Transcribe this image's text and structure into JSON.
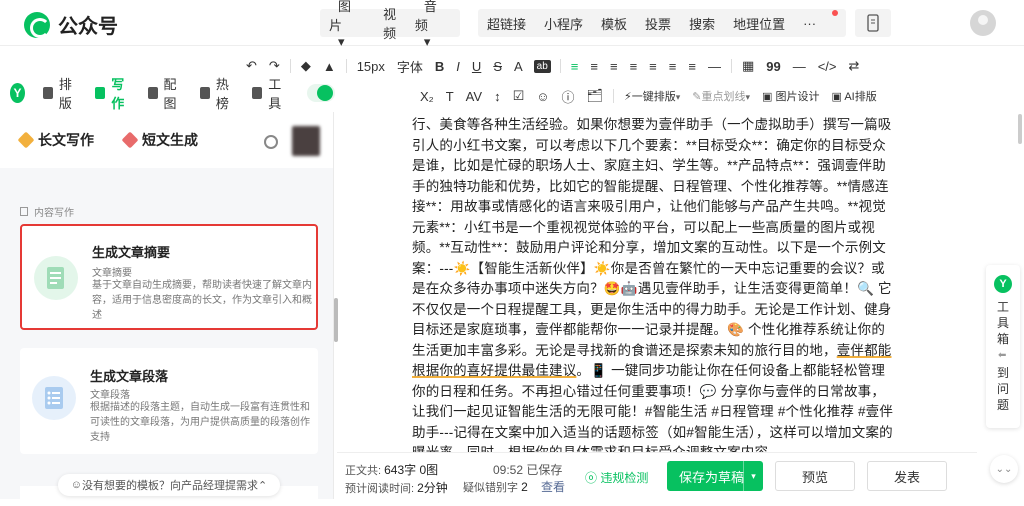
{
  "app": {
    "name": "公众号"
  },
  "topnav": {
    "group1": [
      "图片",
      "视频",
      "音频"
    ],
    "group2": [
      "超链接",
      "小程序",
      "模板",
      "投票",
      "搜索",
      "地理位置"
    ],
    "more": "···"
  },
  "toolbar1": [
    "↶",
    "↷",
    "◆",
    "▲",
    "15px",
    "字体",
    "B",
    "I",
    "U",
    "S",
    "A",
    "ab",
    "≡",
    "≡",
    "≡",
    "≡",
    "≡",
    "≡",
    "≡",
    "—",
    "▦",
    "99",
    "—",
    "</>",
    "⇄"
  ],
  "toolbar2": [
    "X₂",
    "T",
    "AV",
    "↕",
    "☑",
    "☺",
    "ⓘ",
    "🗂",
    "一键排版",
    "重点划线",
    "图片设计",
    "AI排版"
  ],
  "sidetabs": {
    "brand": "Y",
    "items": [
      "排版",
      "写作",
      "配图",
      "热榜",
      "工具"
    ],
    "active": 1
  },
  "sidebar": {
    "modes": [
      "长文写作",
      "短文生成"
    ],
    "section_label": "内容写作",
    "cards": [
      {
        "title": "生成文章摘要",
        "subtitle": "文章摘要",
        "desc": "基于文章自动生成摘要，帮助读者快速了解文章内容，适用于信息密度高的长文，作为文章引入和概述"
      },
      {
        "title": "生成文章段落",
        "subtitle": "文章段落",
        "desc": "根据描述的段落主题，自动生成一段富有连贯性和可读性的文章段落，为用户提供高质量的段落创作支持"
      }
    ],
    "feedback": "没有想要的模板？向产品经理提需求"
  },
  "editor": {
    "before_highlight": "行、美食等各种生活经验。如果你想要为壹伴助手（一个虚拟助手）撰写一篇吸引人的小红书文案，可以考虑以下几个要素：**目标受众**：确定你的目标受众是谁，比如是忙碌的职场人士、家庭主妇、学生等。**产品特点**：强调壹伴助手的独特功能和优势，比如它的智能提醒、日程管理、个性化推荐等。**情感连接**：用故事或情感化的语言来吸引用户，让他们能够与产品产生共鸣。**视觉元素**：小红书是一个重视视觉体验的平台，可以配上一些高质量的图片或视频。**互动性**：鼓励用户评论和分享，增加文案的互动性。以下是一个示例文案：---☀️【智能生活新伙伴】☀️你是否曾在繁忙的一天中忘记重要的会议？或是在众多待办事项中迷失方向？🤩🤖遇见壹伴助手，让生活变得更简单！🔍 它不仅仅是一个日程提醒工具，更是你生活中的得力助手。无论是工作计划、健身目标还是家庭琐事，壹伴都能帮你一一记录并提醒。🎨 个性化推荐系统让你的生活更加丰富多彩。无论是寻找新的食谱还是探索未知的旅行目的地，",
    "highlight": "壹伴都能根据你的喜好提供最佳建议",
    "after_highlight": "。📱 一键同步功能让你在任何设备上都能轻松管理你的日程和任务。不再担心错过任何重要事项！💬 分享你与壹伴的日常故事，让我们一起见证智能生活的无限可能！#智能生活 #日程管理 #个性化推荐 #壹伴助手---记得在文案中加入适当的话题标签（如#智能生活），这样可以增加文案的曝光率。同时，根据你的具体需求和目标受众调整文案内容。"
  },
  "status": {
    "word_count_label": "正文共:",
    "word_count": "643字 0图",
    "read_time_label": "预计阅读时间:",
    "read_time": "2分钟",
    "saved": "09:52 已保存",
    "typo_label": "疑似错别字",
    "typo_count": "2",
    "typo_view": "查看",
    "check": "违规检测",
    "save_draft": "保存为草稿",
    "preview": "预览",
    "publish": "发表"
  },
  "rightpanel": {
    "brand": "Y",
    "toolbox": "工具箱",
    "back": "到问题"
  },
  "colors": {
    "brand_green": "#07c160",
    "highlight_red": "#e53935",
    "link": "#576b95"
  }
}
